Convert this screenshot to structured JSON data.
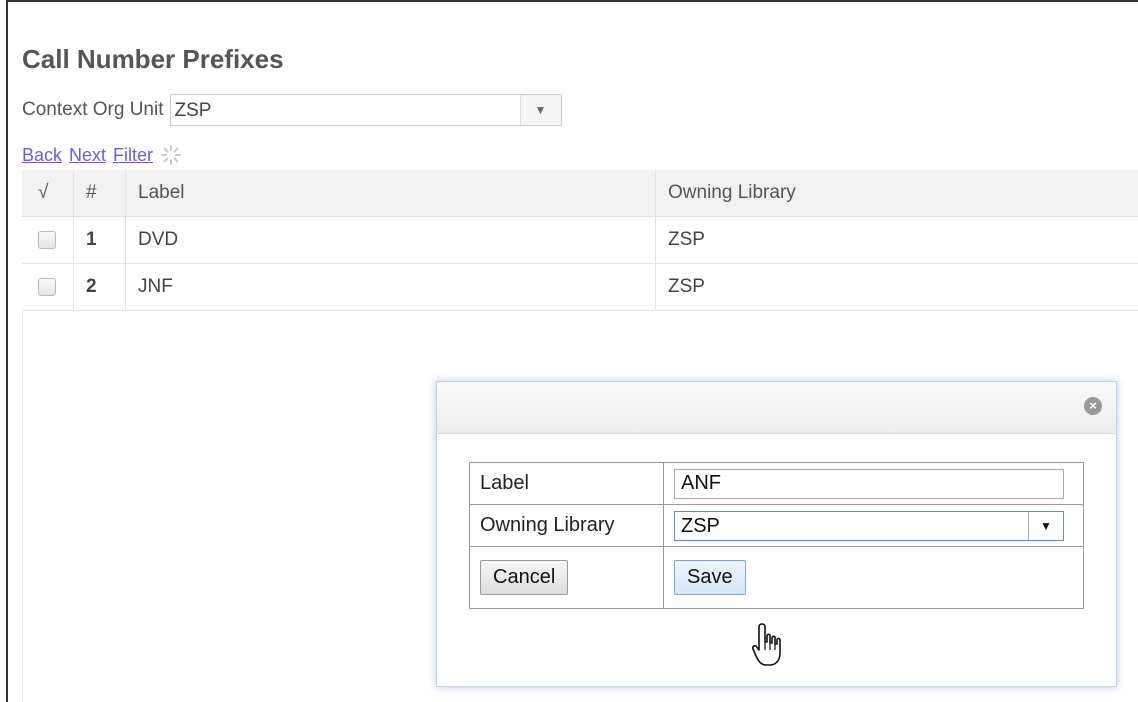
{
  "page": {
    "title": "Call Number Prefixes",
    "context_org_label": "Context Org Unit",
    "context_org_value": "ZSP"
  },
  "nav_links": {
    "back": "Back",
    "next": "Next",
    "filter": "Filter"
  },
  "grid": {
    "columns": {
      "check": "√",
      "num": "#",
      "label": "Label",
      "owning_library": "Owning Library"
    },
    "rows": [
      {
        "num": "1",
        "label": "DVD",
        "owning_library": "ZSP"
      },
      {
        "num": "2",
        "label": "JNF",
        "owning_library": "ZSP"
      }
    ]
  },
  "dialog": {
    "label_field_name": "Label",
    "label_field_value": "ANF",
    "owning_library_field_name": "Owning Library",
    "owning_library_value": "ZSP",
    "cancel_label": "Cancel",
    "save_label": "Save"
  },
  "icons": {
    "dropdown": "chevron-down-icon",
    "spinner": "loading-spinner-icon",
    "close": "close-icon",
    "cursor": "hand-pointer-icon"
  }
}
